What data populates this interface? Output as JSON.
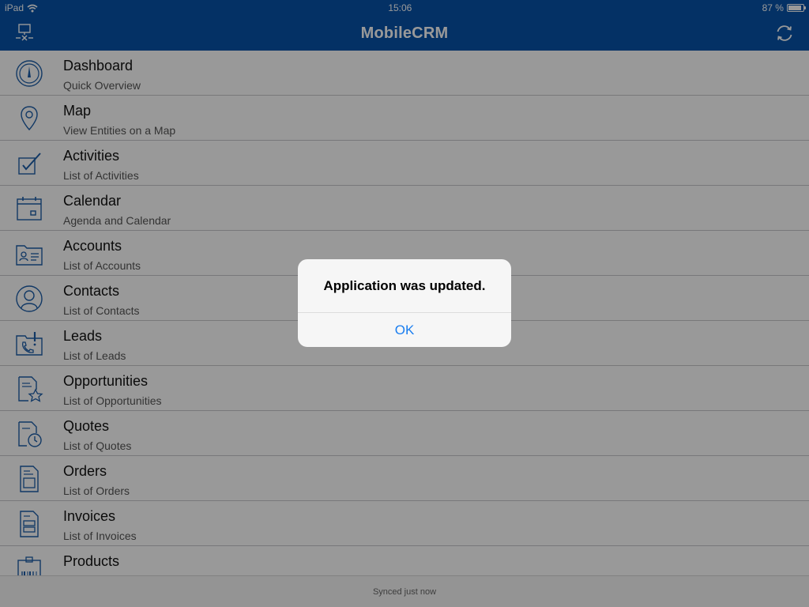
{
  "status_bar": {
    "device": "iPad",
    "time": "15:06",
    "battery": "87 %",
    "battery_level": 0.87
  },
  "navbar": {
    "title": "MobileCRM",
    "left_icon": "disconnect-icon",
    "right_icon": "sync-icon"
  },
  "menu": [
    {
      "label": "Dashboard",
      "sub": "Quick Overview",
      "icon": "dashboard-icon"
    },
    {
      "label": "Map",
      "sub": "View Entities on a Map",
      "icon": "map-pin-icon"
    },
    {
      "label": "Activities",
      "sub": "List of Activities",
      "icon": "checkbox-pencil-icon"
    },
    {
      "label": "Calendar",
      "sub": "Agenda and Calendar",
      "icon": "calendar-icon"
    },
    {
      "label": "Accounts",
      "sub": "List of Accounts",
      "icon": "folder-id-icon"
    },
    {
      "label": "Contacts",
      "sub": "List of Contacts",
      "icon": "user-circle-icon"
    },
    {
      "label": "Leads",
      "sub": "List of Leads",
      "icon": "phone-alert-icon"
    },
    {
      "label": "Opportunities",
      "sub": "List of Opportunities",
      "icon": "document-star-icon"
    },
    {
      "label": "Quotes",
      "sub": "List of Quotes",
      "icon": "document-clock-icon"
    },
    {
      "label": "Orders",
      "sub": "List of Orders",
      "icon": "document-icon"
    },
    {
      "label": "Invoices",
      "sub": "List of Invoices",
      "icon": "invoice-icon"
    },
    {
      "label": "Products",
      "sub": "",
      "icon": "barcode-box-icon"
    }
  ],
  "footer": {
    "sync_status": "Synced just now"
  },
  "alert": {
    "message": "Application was updated.",
    "ok_label": "OK"
  },
  "colors": {
    "brand": "#0853a8",
    "icon": "#1d5ea8",
    "link": "#1a7ef0"
  }
}
